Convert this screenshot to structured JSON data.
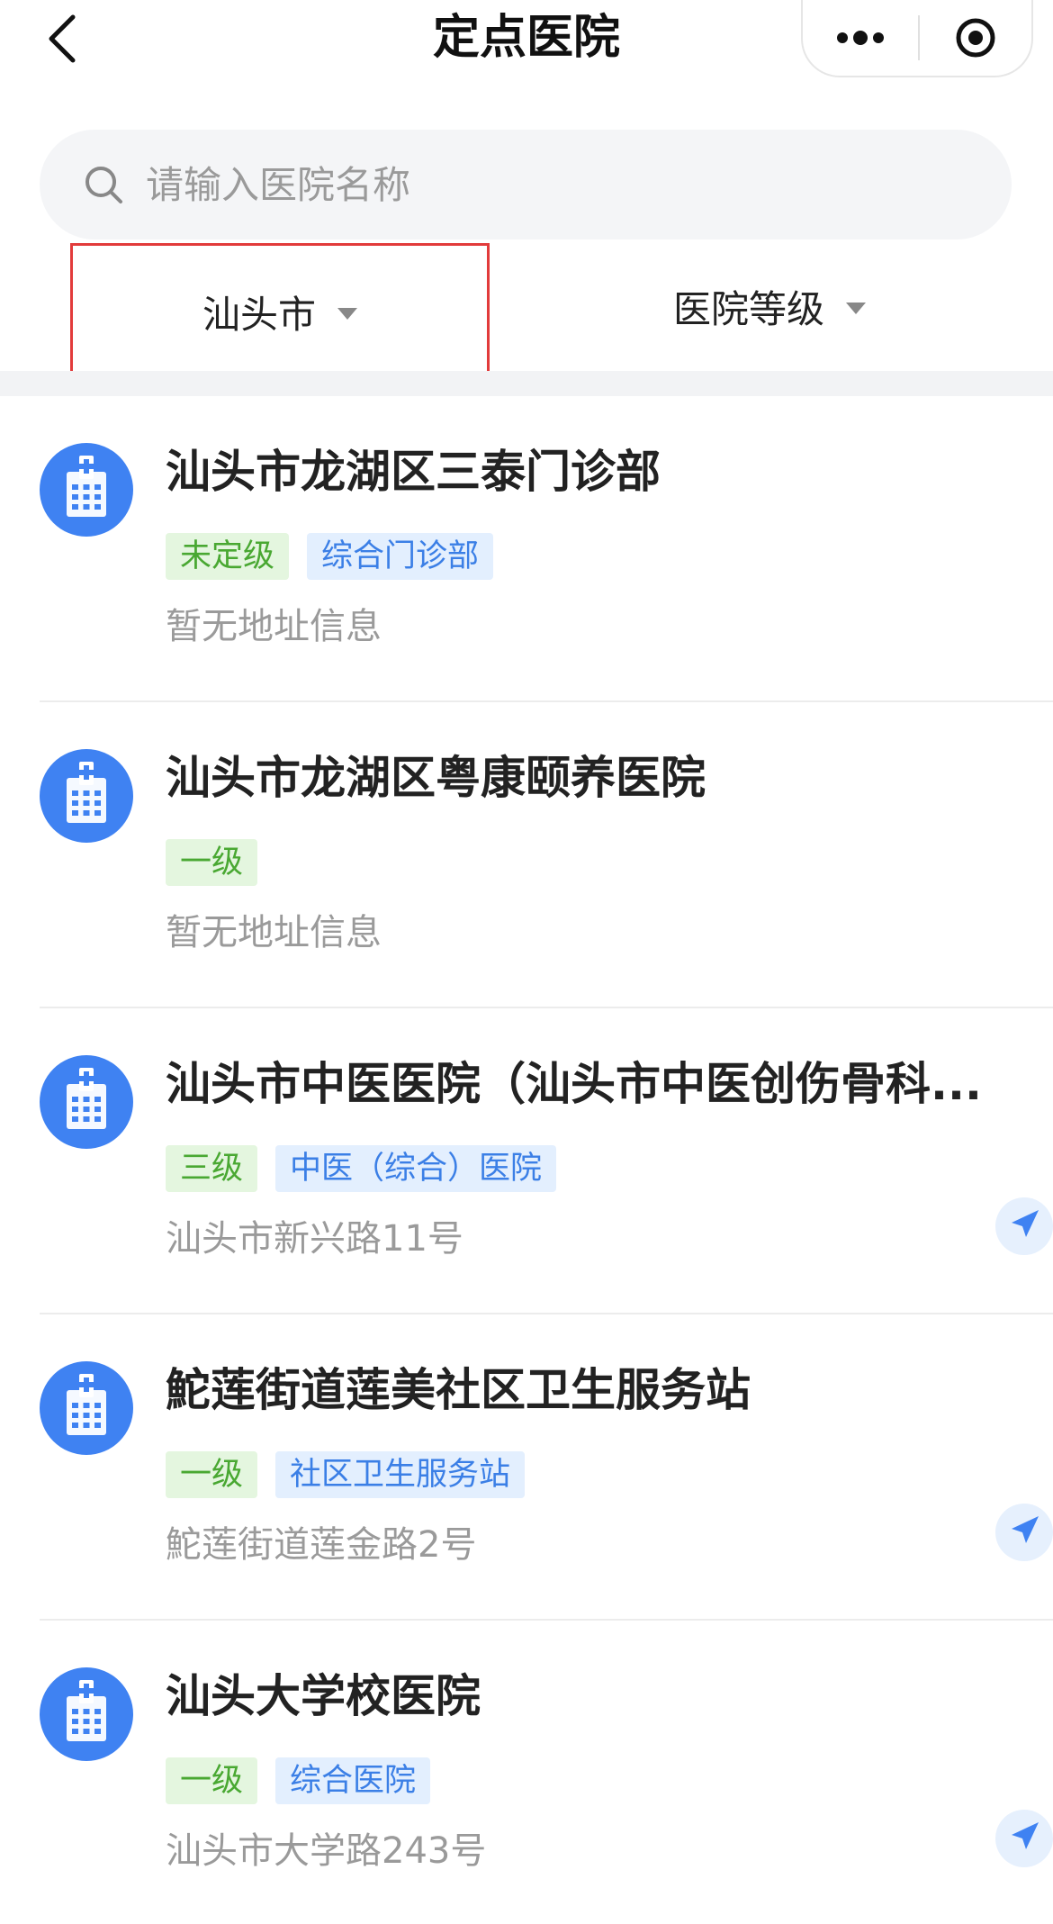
{
  "header": {
    "title": "定点医院",
    "back_icon": "back-chevron-icon",
    "more_icon": "more-dots-icon",
    "close_icon": "target-close-icon"
  },
  "search": {
    "placeholder": "请输入医院名称",
    "value": ""
  },
  "filters": {
    "city": "汕头市",
    "level": "医院等级"
  },
  "colors": {
    "accent_blue": "#3f82f2",
    "tag_green_text": "#49a832",
    "tag_blue_text": "#3b7fe6",
    "highlight_box": "#e23b3b"
  },
  "hospitals": [
    {
      "name": "汕头市龙湖区三泰门诊部",
      "tags": [
        {
          "text": "未定级",
          "color": "green"
        },
        {
          "text": "综合门诊部",
          "color": "blue"
        }
      ],
      "address": "暂无地址信息",
      "has_nav": false
    },
    {
      "name": "汕头市龙湖区粤康颐养医院",
      "tags": [
        {
          "text": "一级",
          "color": "green"
        }
      ],
      "address": "暂无地址信息",
      "has_nav": false
    },
    {
      "name": "汕头市中医医院（汕头市中医创伤骨科...",
      "tags": [
        {
          "text": "三级",
          "color": "green"
        },
        {
          "text": "中医（综合）医院",
          "color": "blue"
        }
      ],
      "address": "汕头市新兴路11号",
      "has_nav": true
    },
    {
      "name": "鮀莲街道莲美社区卫生服务站",
      "tags": [
        {
          "text": "一级",
          "color": "green"
        },
        {
          "text": "社区卫生服务站",
          "color": "blue"
        }
      ],
      "address": "鮀莲街道莲金路2号",
      "has_nav": true
    },
    {
      "name": "汕头大学校医院",
      "tags": [
        {
          "text": "一级",
          "color": "green"
        },
        {
          "text": "综合医院",
          "color": "blue"
        }
      ],
      "address": "汕头市大学路243号",
      "has_nav": true
    }
  ]
}
